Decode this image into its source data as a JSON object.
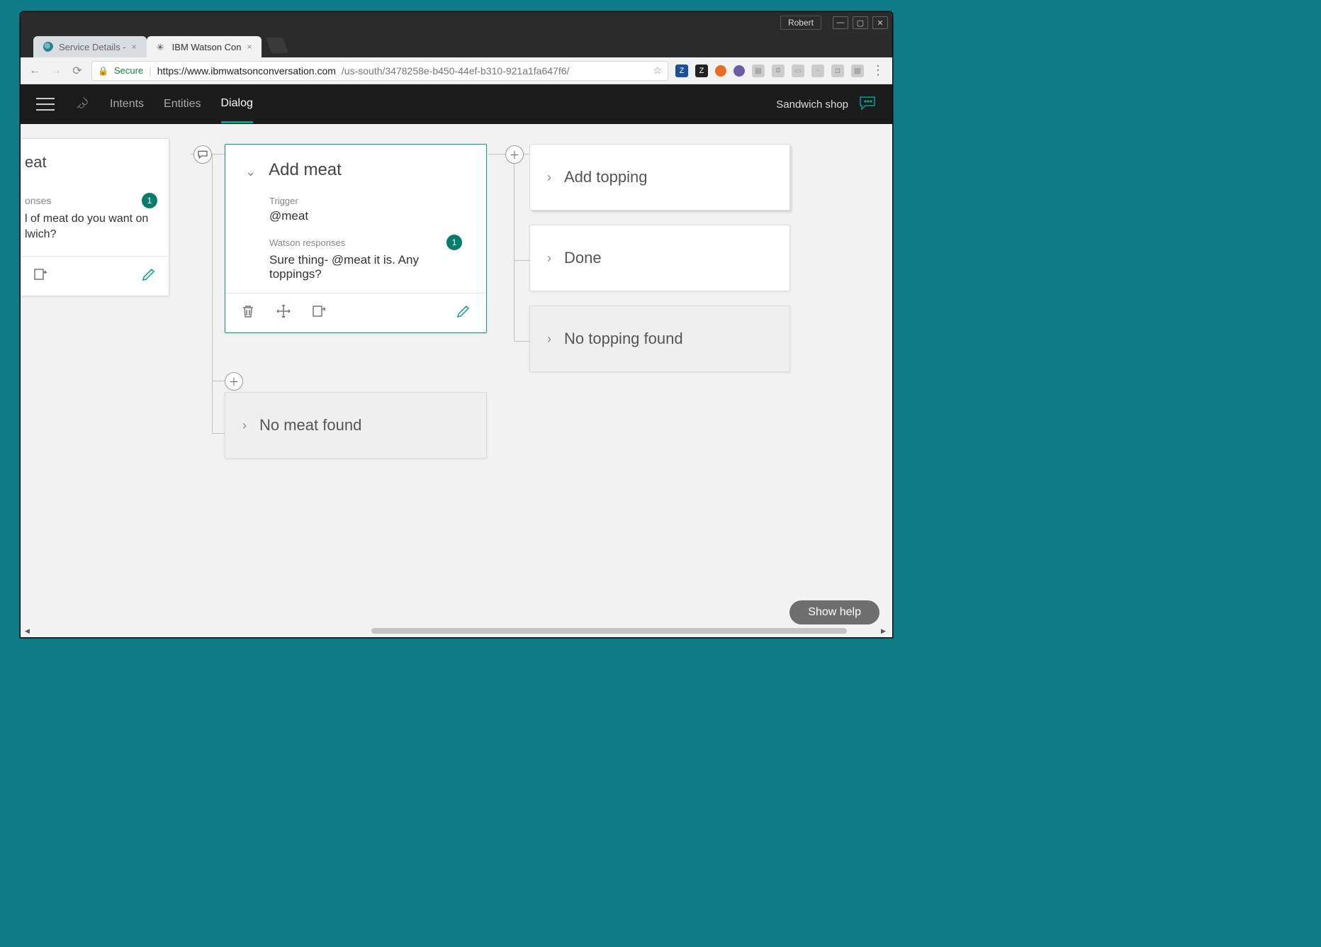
{
  "os": {
    "username": "Robert"
  },
  "tabs": [
    {
      "title": "Service Details - ",
      "active": false
    },
    {
      "title": "IBM Watson Con",
      "active": true
    }
  ],
  "browser": {
    "secure_label": "Secure",
    "url_host": "https://www.ibmwatsonconversation.com",
    "url_path": "/us-south/3478258e-b450-44ef-b310-921a1fa647f6/"
  },
  "app": {
    "nav": {
      "intents": "Intents",
      "entities": "Entities",
      "dialog": "Dialog"
    },
    "workspace": "Sandwich shop"
  },
  "left_node": {
    "title_fragment": "eat",
    "responses_label_fragment": "onses",
    "responses_count": "1",
    "question_fragment": "l of meat do you want on lwich?"
  },
  "selected_node": {
    "title": "Add meat",
    "trigger_label": "Trigger",
    "trigger_value": "@meat",
    "responses_label": "Watson responses",
    "responses_count": "1",
    "response_text": "Sure thing- @meat it is. Any toppings?"
  },
  "sibling_node": {
    "title": "No meat found"
  },
  "children": {
    "add_topping": "Add topping",
    "done": "Done",
    "no_topping_found": "No topping found"
  },
  "footer": {
    "show_help": "Show help"
  }
}
